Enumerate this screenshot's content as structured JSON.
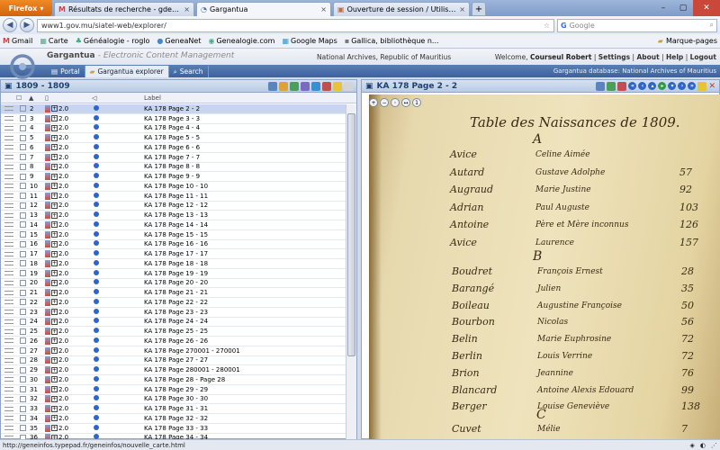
{
  "browser": {
    "app_button": "Firefox",
    "tabs": [
      {
        "title": "Résultats de recherche - gdemorant...",
        "icon": "gmail-icon"
      },
      {
        "title": "Gargantua",
        "icon": "gargantua-icon",
        "active": true
      },
      {
        "title": "Ouverture de session / Utilisateur - w...",
        "icon": "session-icon"
      }
    ],
    "url": "www1.gov.mu/siatel-web/explorer/",
    "search_placeholder": "Google",
    "bookmarks": [
      "Gmail",
      "Carte",
      "Généalogie - roglo",
      "GeneaNet",
      "Genealogie.com",
      "Google Maps",
      "Gallica, bibliothèque n..."
    ],
    "bookmarks_menu": "Marque-pages"
  },
  "app": {
    "brand": "Gargantua",
    "brand_sub": "- Electronic Content Management",
    "institution": "National Archives, Republic of Mauritius",
    "welcome": "Welcome,",
    "user": "Courseul Robert",
    "links": [
      "Settings",
      "About",
      "Help",
      "Logout"
    ],
    "tabs": [
      "Portal",
      "Gargantua explorer",
      "Search"
    ],
    "db_info": "Gargantua database: National Archives of Mauritius"
  },
  "left_panel": {
    "title": "1809 - 1809",
    "column_label": "Label",
    "rows": [
      {
        "num": "2",
        "ver": "2.0",
        "label": "KA 178 Page 2 - 2",
        "selected": true
      },
      {
        "num": "3",
        "ver": "2.0",
        "label": "KA 178 Page 3 - 3"
      },
      {
        "num": "4",
        "ver": "2.0",
        "label": "KA 178 Page 4 - 4"
      },
      {
        "num": "5",
        "ver": "2.0",
        "label": "KA 178 Page 5 - 5"
      },
      {
        "num": "6",
        "ver": "2.0",
        "label": "KA 178 Page 6 - 6"
      },
      {
        "num": "7",
        "ver": "2.0",
        "label": "KA 178 Page 7 - 7"
      },
      {
        "num": "8",
        "ver": "2.0",
        "label": "KA 178 Page 8 - 8"
      },
      {
        "num": "9",
        "ver": "2.0",
        "label": "KA 178 Page 9 - 9"
      },
      {
        "num": "10",
        "ver": "2.0",
        "label": "KA 178 Page 10 - 10"
      },
      {
        "num": "11",
        "ver": "2.0",
        "label": "KA 178 Page 11 - 11"
      },
      {
        "num": "12",
        "ver": "2.0",
        "label": "KA 178 Page 12 - 12"
      },
      {
        "num": "13",
        "ver": "2.0",
        "label": "KA 178 Page 13 - 13"
      },
      {
        "num": "14",
        "ver": "2.0",
        "label": "KA 178 Page 14 - 14"
      },
      {
        "num": "15",
        "ver": "2.0",
        "label": "KA 178 Page 15 - 15"
      },
      {
        "num": "16",
        "ver": "2.0",
        "label": "KA 178 Page 16 - 16"
      },
      {
        "num": "17",
        "ver": "2.0",
        "label": "KA 178 Page 17 - 17"
      },
      {
        "num": "18",
        "ver": "2.0",
        "label": "KA 178 Page 18 - 18"
      },
      {
        "num": "19",
        "ver": "2.0",
        "label": "KA 178 Page 19 - 19"
      },
      {
        "num": "20",
        "ver": "2.0",
        "label": "KA 178 Page 20 - 20"
      },
      {
        "num": "21",
        "ver": "2.0",
        "label": "KA 178 Page 21 - 21"
      },
      {
        "num": "22",
        "ver": "2.0",
        "label": "KA 178 Page 22 - 22"
      },
      {
        "num": "23",
        "ver": "2.0",
        "label": "KA 178 Page 23 - 23"
      },
      {
        "num": "24",
        "ver": "2.0",
        "label": "KA 178 Page 24 - 24"
      },
      {
        "num": "25",
        "ver": "2.0",
        "label": "KA 178 Page 25 - 25"
      },
      {
        "num": "26",
        "ver": "2.0",
        "label": "KA 178 Page 26 - 26"
      },
      {
        "num": "27",
        "ver": "2.0",
        "label": "KA 178 Page 270001 - 270001"
      },
      {
        "num": "28",
        "ver": "2.0",
        "label": "KA 178 Page 27 - 27"
      },
      {
        "num": "29",
        "ver": "2.0",
        "label": "KA 178 Page 280001 - 280001"
      },
      {
        "num": "30",
        "ver": "2.0",
        "label": "KA 178 Page 28 - Page 28"
      },
      {
        "num": "31",
        "ver": "2.0",
        "label": "KA 178 Page 29 - 29"
      },
      {
        "num": "32",
        "ver": "2.0",
        "label": "KA 178 Page 30 - 30"
      },
      {
        "num": "33",
        "ver": "2.0",
        "label": "KA 178 Page 31 - 31"
      },
      {
        "num": "34",
        "ver": "2.0",
        "label": "KA 178 Page 32 - 32"
      },
      {
        "num": "35",
        "ver": "2.0",
        "label": "KA 178 Page 33 - 33"
      },
      {
        "num": "36",
        "ver": "2.0",
        "label": "KA 178 Page 34 - 34"
      }
    ]
  },
  "right_panel": {
    "title": "KA 178 Page 2 - 2",
    "doc_title": "Table des Naissances de 1809.",
    "doc_letter": "A",
    "doc_letter2": "B",
    "doc_letter3": "C",
    "entries_a": [
      {
        "name": "Avice",
        "given": "Celine Aimée",
        "page": ""
      },
      {
        "name": "Autard",
        "given": "Gustave Adolphe",
        "page": "57"
      },
      {
        "name": "Augraud",
        "given": "Marie Justine",
        "page": "92"
      },
      {
        "name": "Adrian",
        "given": "Paul Auguste",
        "page": "103"
      },
      {
        "name": "Antoine",
        "given": "Père et Mère inconnus",
        "page": "126"
      },
      {
        "name": "Avice",
        "given": "Laurence",
        "page": "157"
      }
    ],
    "entries_b": [
      {
        "name": "Boudret",
        "given": "François Ernest",
        "page": "28"
      },
      {
        "name": "Barangé",
        "given": "Julien",
        "page": "35"
      },
      {
        "name": "Boileau",
        "given": "Augustine Françoise",
        "page": "50"
      },
      {
        "name": "Bourbon",
        "given": "Nicolas",
        "page": "56"
      },
      {
        "name": "Belin",
        "given": "Marie Euphrosine",
        "page": "72"
      },
      {
        "name": "Berlin",
        "given": "Louis Verrine",
        "page": "72"
      },
      {
        "name": "Brion",
        "given": "Jeannine",
        "page": "76"
      },
      {
        "name": "Blancard",
        "given": "Antoine Alexis Edouard",
        "page": "99"
      },
      {
        "name": "Berger",
        "given": "Louise Geneviève",
        "page": "138"
      }
    ],
    "entries_c": [
      {
        "name": "Cuvet",
        "given": "Mélie",
        "page": "7"
      }
    ]
  },
  "statusbar": {
    "text": "http://geneinfos.typepad.fr/geneinfos/nouvelle_carte.html"
  },
  "colors": {
    "accent": "#3d6198",
    "panel_title": "#1f3f73",
    "selection": "#c7d6ee"
  }
}
